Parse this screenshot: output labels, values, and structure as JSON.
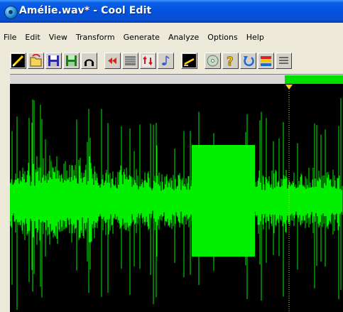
{
  "window": {
    "title": "Amélie.wav* - Cool Edit",
    "icon": "cool-edit-app-icon"
  },
  "menu": [
    "File",
    "Edit",
    "View",
    "Transform",
    "Generate",
    "Analyze",
    "Options",
    "Help"
  ],
  "toolbar": {
    "buttons": [
      "new-waveform-icon",
      "open-file-icon",
      "save-icon",
      "save-selection-icon",
      "headphones-icon",
      "rewind-icon",
      "waveform-view-icon",
      "loop-icon",
      "note-icon",
      "pencil-icon",
      "cd-icon",
      "help-icon",
      "undo-icon",
      "level-icon",
      "options-icon"
    ]
  },
  "colors": {
    "waveform": "#00f000",
    "background": "#000000",
    "cursor": "#f2d20c",
    "titlebar": "#0353df"
  }
}
